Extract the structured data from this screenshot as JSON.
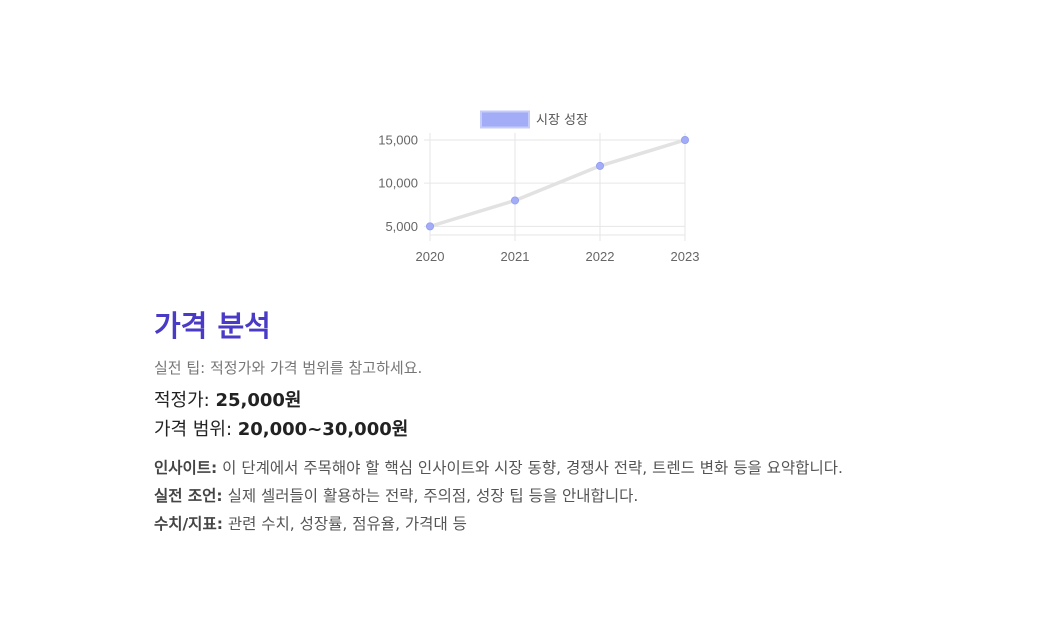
{
  "chart_data": {
    "type": "line",
    "categories": [
      "2020",
      "2021",
      "2022",
      "2023"
    ],
    "series": [
      {
        "name": "시장 성장",
        "values": [
          5000,
          8000,
          12000,
          15000
        ]
      }
    ],
    "yticks": [
      "5,000",
      "10,000",
      "15,000"
    ],
    "ytick_values": [
      5000,
      10000,
      15000
    ],
    "ylim": [
      4000,
      15000
    ],
    "grid": true,
    "legend": "top",
    "colors": {
      "line": "#e2e2e2",
      "point": "#a3adf7",
      "legend_box": "#a3adf7"
    }
  },
  "section": {
    "title": "가격 분석",
    "tip": "실전 팁: 적정가와 가격 범위를 참고하세요."
  },
  "metrics": {
    "fair_label": "적정가: ",
    "fair_value": "25,000원",
    "range_label": "가격 범위: ",
    "range_value": "20,000~30,000원"
  },
  "notes": {
    "insight_label": "인사이트:",
    "insight_text": " 이 단계에서 주목해야 할 핵심 인사이트와 시장 동향, 경쟁사 전략, 트렌드 변화 등을 요약합니다.",
    "advice_label": "실전 조언:",
    "advice_text": " 실제 셀러들이 활용하는 전략, 주의점, 성장 팁 등을 안내합니다.",
    "metric_label": "수치/지표:",
    "metric_text": " 관련 수치, 성장률, 점유율, 가격대 등"
  }
}
